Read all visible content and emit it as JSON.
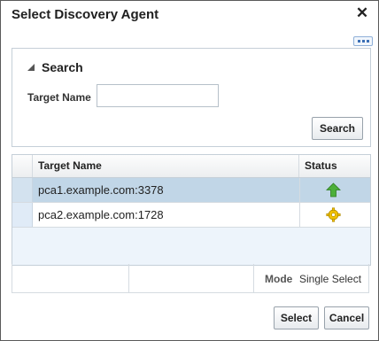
{
  "dialog": {
    "title": "Select Discovery Agent",
    "close_icon": "close-icon",
    "more_icon": "more-options-icon"
  },
  "search": {
    "heading": "Search",
    "collapse_icon": "expanded-triangle-icon",
    "target_name_label": "Target Name",
    "target_name_value": "",
    "target_name_placeholder": "",
    "search_button_label": "Search"
  },
  "table": {
    "columns": [
      "Target Name",
      "Status"
    ],
    "rows": [
      {
        "name": "pca1.example.com:3378",
        "status": "up",
        "status_icon": "status-up-arrow-icon",
        "selected": true
      },
      {
        "name": "pca2.example.com:1728",
        "status": "pending",
        "status_icon": "status-pending-gear-icon",
        "selected": false
      }
    ]
  },
  "footer": {
    "mode_label": "Mode",
    "mode_value": "Single Select"
  },
  "buttons": {
    "select_label": "Select",
    "cancel_label": "Cancel"
  },
  "colors": {
    "selected_row": "#c1d6e7",
    "status_up": "#4caf3a",
    "status_pending": "#f2c200"
  }
}
